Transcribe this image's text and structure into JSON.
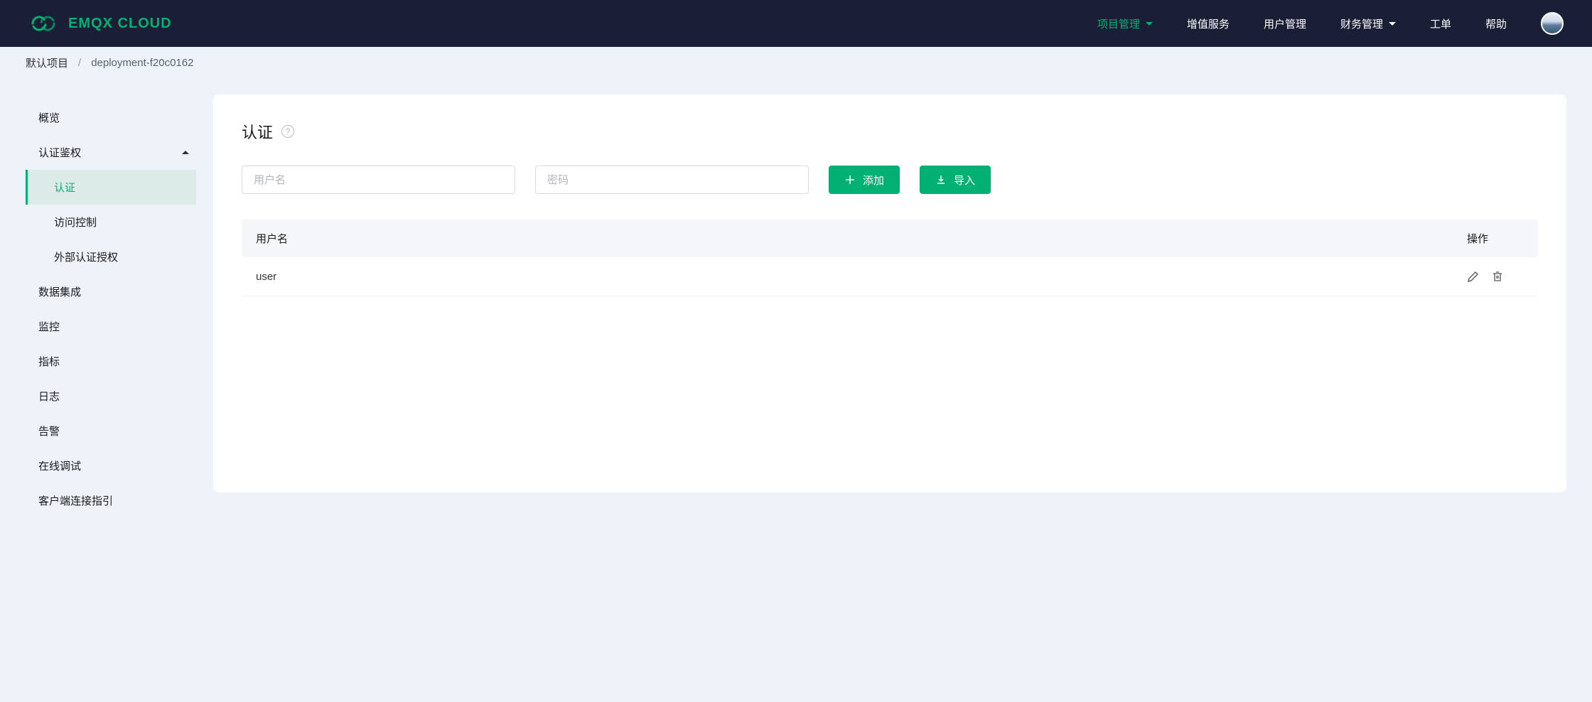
{
  "header": {
    "logo_text": "EMQX CLOUD",
    "nav": [
      {
        "label": "项目管理",
        "dropdown": true,
        "active": true
      },
      {
        "label": "增值服务",
        "dropdown": false,
        "active": false
      },
      {
        "label": "用户管理",
        "dropdown": false,
        "active": false
      },
      {
        "label": "财务管理",
        "dropdown": true,
        "active": false
      },
      {
        "label": "工单",
        "dropdown": false,
        "active": false
      },
      {
        "label": "帮助",
        "dropdown": false,
        "active": false
      }
    ]
  },
  "breadcrumb": {
    "root": "默认项目",
    "current": "deployment-f20c0162"
  },
  "sidebar": {
    "items": [
      {
        "label": "概览",
        "type": "item"
      },
      {
        "label": "认证鉴权",
        "type": "expandable",
        "expanded": true,
        "children": [
          {
            "label": "认证",
            "active": true
          },
          {
            "label": "访问控制",
            "active": false
          },
          {
            "label": "外部认证授权",
            "active": false
          }
        ]
      },
      {
        "label": "数据集成",
        "type": "item"
      },
      {
        "label": "监控",
        "type": "item"
      },
      {
        "label": "指标",
        "type": "item"
      },
      {
        "label": "日志",
        "type": "item"
      },
      {
        "label": "告警",
        "type": "item"
      },
      {
        "label": "在线调试",
        "type": "item"
      },
      {
        "label": "客户端连接指引",
        "type": "item"
      }
    ]
  },
  "content": {
    "title": "认证",
    "inputs": {
      "username_placeholder": "用户名",
      "password_placeholder": "密码"
    },
    "buttons": {
      "add": "添加",
      "import": "导入"
    },
    "table": {
      "columns": {
        "username": "用户名",
        "actions": "操作"
      },
      "rows": [
        {
          "username": "user"
        }
      ]
    }
  }
}
